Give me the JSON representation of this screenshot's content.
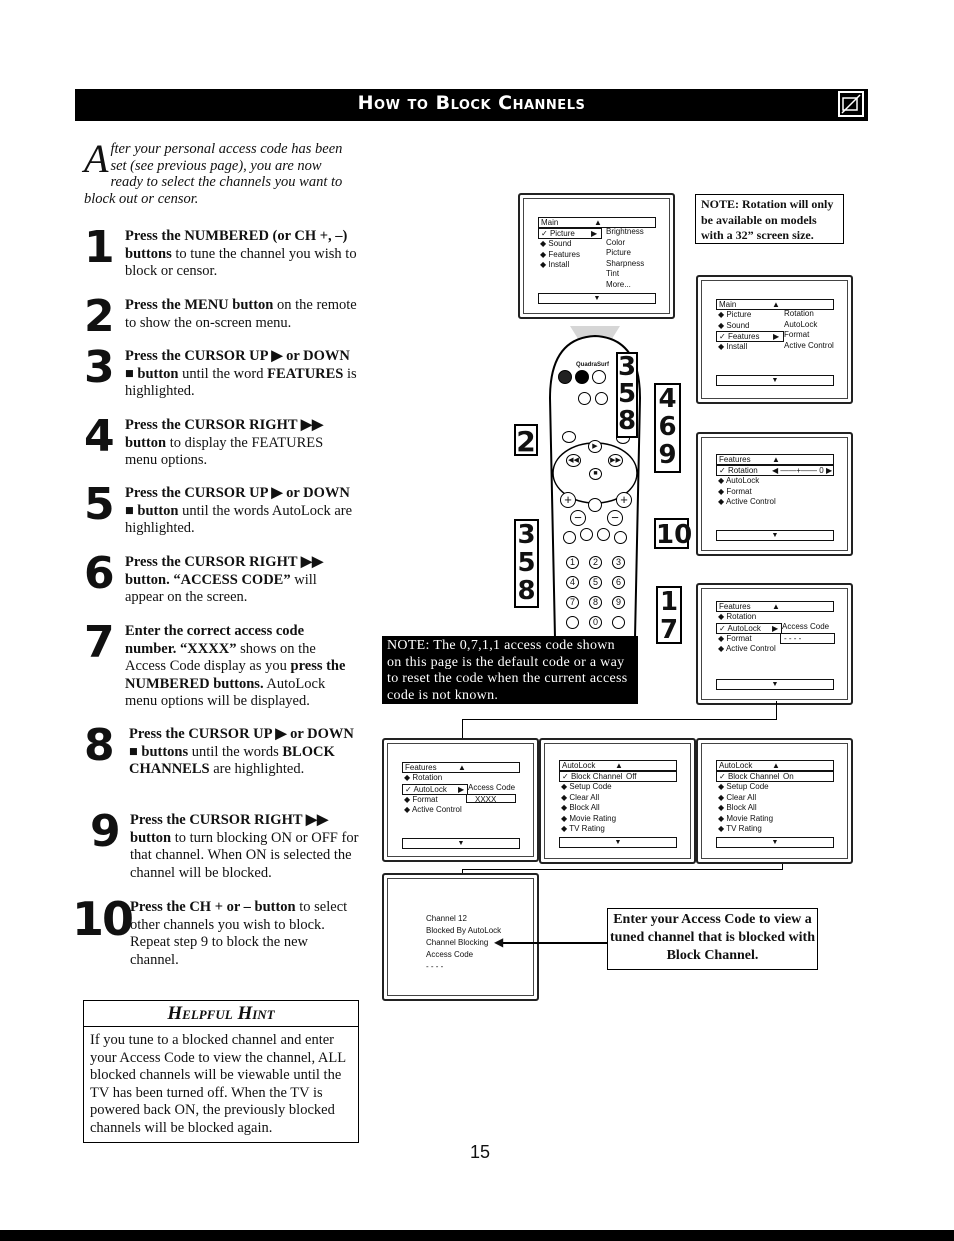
{
  "header": {
    "title": "How to Block Channels",
    "icon": "tv-remote-icon"
  },
  "intro": {
    "drop_cap": "A",
    "text": "fter your personal access code has been set (see previous page), you are now ready to select the channels you want to block out or censor."
  },
  "steps": [
    {
      "num": "1",
      "bold": "Press the NUMBERED (or CH +, –) buttons",
      "rest": " to tune the channel you wish to block or censor."
    },
    {
      "num": "2",
      "bold": "Press the MENU button",
      "rest": " on the remote to show the on-screen menu."
    },
    {
      "num": "3",
      "bold": "Press the CURSOR UP ▶ or DOWN ■ button",
      "rest": " until the word ",
      "bold2": "FEATURES",
      "rest2": " is highlighted."
    },
    {
      "num": "4",
      "bold": "Press the CURSOR RIGHT ▶▶ button",
      "rest": " to display the FEATURES menu options."
    },
    {
      "num": "5",
      "bold": "Press the CURSOR UP ▶ or DOWN ■ button",
      "rest": " until the words AutoLock are highlighted."
    },
    {
      "num": "6",
      "bold": "Press the CURSOR RIGHT ▶▶ button. “ACCESS CODE”",
      "rest": " will appear on the screen."
    },
    {
      "num": "7",
      "bold": "Enter the correct access code number. “XXXX”",
      "rest": " shows on the Access Code display as you ",
      "bold2": "press the NUMBERED buttons.",
      "rest2": " AutoLock menu options will be displayed."
    },
    {
      "num": "8",
      "bold": "Press the CURSOR UP ▶ or DOWN ■ buttons",
      "rest": " until the words ",
      "bold2": "BLOCK CHANNELS",
      "rest2": " are highlighted."
    },
    {
      "num": "9",
      "bold": "Press the CURSOR RIGHT ▶▶ button",
      "rest": " to turn blocking ON or OFF for that channel. When ON is selected the channel will be blocked."
    },
    {
      "num": "10",
      "bold": "Press the CH + or – button",
      "rest": " to select other channels you wish to block. Repeat step 9 to block the new channel."
    }
  ],
  "hint": {
    "title": "Helpful Hint",
    "body": "If you tune to a blocked channel and enter your Access Code to view the channel, ALL blocked channels will be viewable until the TV has been turned off. When the TV is powered back ON, the previously blocked channels will be blocked again."
  },
  "notes": {
    "rotation": "NOTE: Rotation will only be available on models with a 32” screen size.",
    "access_code": "NOTE: The 0,7,1,1 access code shown on this page is the default code or a way to reset the code when the current access code is not known.",
    "enter_code": "Enter your Access Code to view a tuned channel that is blocked with Block Channel."
  },
  "screens": {
    "main1": {
      "header": "Main",
      "items": [
        "Picture",
        "Sound",
        "Features",
        "Install"
      ],
      "selected": "Picture",
      "sub": [
        "Brightness",
        "Color",
        "Picture",
        "Sharpness",
        "Tint",
        "More..."
      ]
    },
    "main2": {
      "header": "Main",
      "items": [
        "Picture",
        "Sound",
        "Features",
        "Install"
      ],
      "selected": "Features",
      "sub": [
        "Rotation",
        "AutoLock",
        "Format",
        "Active Control"
      ]
    },
    "features1": {
      "header": "Features",
      "items": [
        "Rotation",
        "AutoLock",
        "Format",
        "Active Control"
      ],
      "selected": "Rotation",
      "value": "0"
    },
    "features2": {
      "header": "Features",
      "items": [
        "Rotation",
        "AutoLock",
        "Format",
        "Active Control"
      ],
      "selected": "AutoLock",
      "sub_label": "Access Code",
      "code": "- - - -"
    },
    "features3": {
      "header": "Features",
      "items": [
        "Rotation",
        "AutoLock",
        "Format",
        "Active Control"
      ],
      "selected": "AutoLock",
      "sub_label": "Access Code",
      "code": "XXXX"
    },
    "autolock_off": {
      "header": "AutoLock",
      "items": [
        "Block Channel",
        "Setup Code",
        "Clear All",
        "Block All",
        "Movie Rating",
        "TV Rating"
      ],
      "selected": "Block Channel",
      "value": "Off"
    },
    "autolock_on": {
      "header": "AutoLock",
      "items": [
        "Block Channel",
        "Setup Code",
        "Clear All",
        "Block All",
        "Movie Rating",
        "TV Rating"
      ],
      "selected": "Block Channel",
      "value": "On"
    },
    "blocked": {
      "lines": [
        "Channel 12",
        "Blocked By AutoLock",
        "Channel Blocking",
        "Access Code",
        "- - - -"
      ]
    }
  },
  "remote": {
    "brand_label": "QuadraSurf",
    "callouts": {
      "menu": "2",
      "up": "3\n5\n8",
      "right": "4\n6\n9",
      "down": "3\n5\n8",
      "ch": "10",
      "digits": "1\n7"
    },
    "numbers": [
      "1",
      "2",
      "3",
      "4",
      "5",
      "6",
      "7",
      "8",
      "9",
      "0"
    ]
  },
  "page_number": "15"
}
